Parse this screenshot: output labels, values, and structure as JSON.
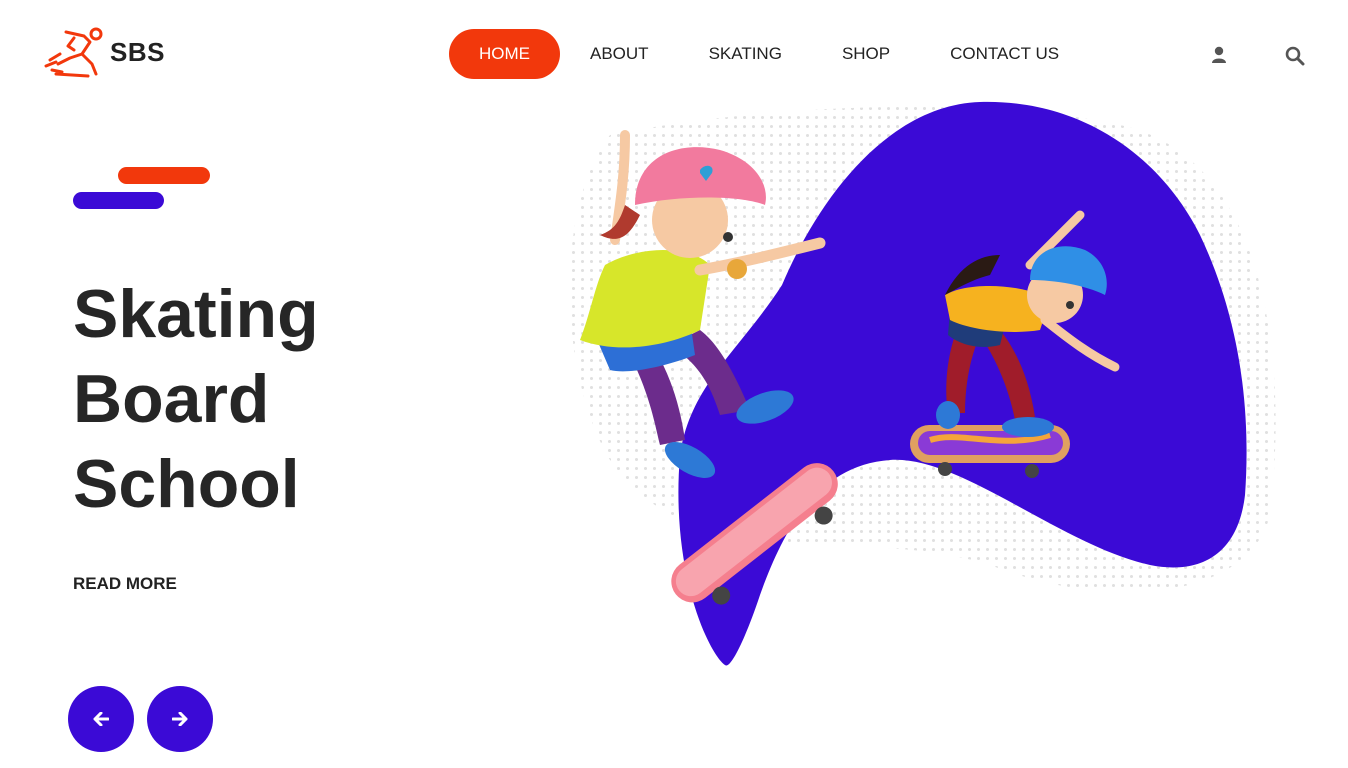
{
  "brand": {
    "name": "SBS",
    "logo_icon": "skater-logo-icon",
    "accent": "#f2380c",
    "primary": "#3b0ad6"
  },
  "nav": {
    "items": [
      {
        "label": "HOME",
        "active": true
      },
      {
        "label": "ABOUT",
        "active": false
      },
      {
        "label": "SKATING",
        "active": false
      },
      {
        "label": "SHOP",
        "active": false
      },
      {
        "label": "CONTACT US",
        "active": false
      }
    ]
  },
  "header_icons": [
    "user-icon",
    "search-icon"
  ],
  "hero": {
    "title_lines": [
      "Skating",
      "Board",
      "School"
    ],
    "read_more": "READ MORE",
    "illustration": "kids-skateboarding-illustration"
  },
  "slider_controls": [
    "arrow-left-icon",
    "arrow-right-icon"
  ]
}
